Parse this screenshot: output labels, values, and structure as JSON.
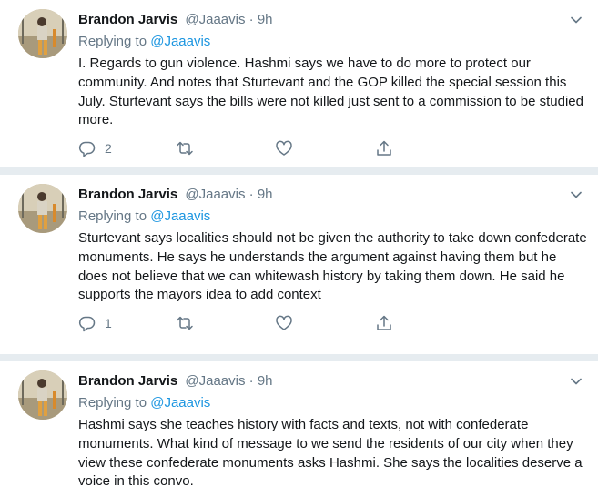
{
  "tweets": [
    {
      "author_name": "Brandon Jarvis",
      "author_handle": "@Jaaavis",
      "separator": "·",
      "time": "9h",
      "replying_prefix": "Replying to ",
      "replying_to": "@Jaaavis",
      "text": "I. Regards to gun violence. Hashmi says we have to do more to protect our community. And notes that Sturtevant and the GOP killed the special session this July. Sturtevant says the bills were not killed just sent to a commission to be studied more.",
      "reply_count": "2",
      "retweet_count": "",
      "like_count": ""
    },
    {
      "author_name": "Brandon Jarvis",
      "author_handle": "@Jaaavis",
      "separator": "·",
      "time": "9h",
      "replying_prefix": "Replying to ",
      "replying_to": "@Jaaavis",
      "text": "Sturtevant says localities should not be given the authority to take down confederate monuments. He says he understands the argument against having them but he does not believe that we can whitewash history by taking them down. He said he supports the mayors idea to add context",
      "reply_count": "1",
      "retweet_count": "",
      "like_count": ""
    },
    {
      "author_name": "Brandon Jarvis",
      "author_handle": "@Jaaavis",
      "separator": "·",
      "time": "9h",
      "replying_prefix": "Replying to ",
      "replying_to": "@Jaaavis",
      "text": "Hashmi says she teaches history with facts and texts, not with confederate monuments. What kind of message to we send the residents of our city when they view these confederate monuments asks Hashmi. She says the localities deserve a voice in this convo.",
      "reply_count": "",
      "retweet_count": "",
      "like_count": ""
    }
  ],
  "icons": {
    "reply": "reply-icon",
    "retweet": "retweet-icon",
    "like": "heart-icon",
    "share": "share-icon",
    "caret": "chevron-down-icon"
  },
  "colors": {
    "name": "#14171a",
    "meta": "#657786",
    "mention": "#1b95e0",
    "divider": "#e6ecf0"
  }
}
